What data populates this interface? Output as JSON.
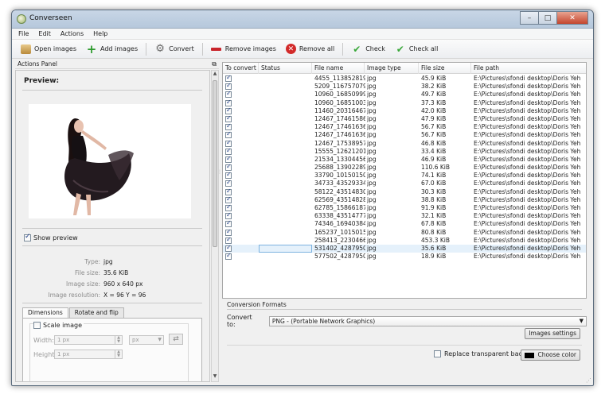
{
  "window": {
    "title": "Converseen",
    "minimize_glyph": "–",
    "maximize_glyph": "□",
    "close_glyph": "✕"
  },
  "menu": [
    "File",
    "Edit",
    "Actions",
    "Help"
  ],
  "toolbar": {
    "open_images": "Open images",
    "add_images": "Add images",
    "convert": "Convert",
    "remove_images": "Remove images",
    "remove_all": "Remove all",
    "check": "Check",
    "check_all": "Check all"
  },
  "actions_panel": {
    "title": "Actions Panel",
    "preview_title": "Preview:",
    "show_preview_label": "Show preview",
    "show_preview_checked": true,
    "info": {
      "type_label": "Type:",
      "type": "jpg",
      "file_size_label": "File size:",
      "file_size": "35.6 KiB",
      "image_size_label": "Image size:",
      "image_size": "960 x 640 px",
      "image_resolution_label": "Image resolution:",
      "image_resolution": "X = 96 Y = 96"
    },
    "tabs": [
      "Dimensions",
      "Rotate and flip"
    ],
    "active_tab": 0,
    "scale_image_label": "Scale image",
    "width_label": "Width:",
    "width_value": "1 px",
    "height_label": "Height:",
    "height_value": "1 px",
    "unit": "px"
  },
  "table": {
    "columns": [
      "To convert",
      "Status",
      "File name",
      "Image type",
      "File size",
      "File path"
    ],
    "selected_index": 21,
    "rows": [
      {
        "name": "4455_113852819...",
        "type": "jpg",
        "size": "45.9 KiB",
        "path": "E:\\Pictures\\sfondi desktop\\Doris Yeh"
      },
      {
        "name": "5209_116757079...",
        "type": "jpg",
        "size": "38.2 KiB",
        "path": "E:\\Pictures\\sfondi desktop\\Doris Yeh"
      },
      {
        "name": "10960_16850999...",
        "type": "jpg",
        "size": "49.7 KiB",
        "path": "E:\\Pictures\\sfondi desktop\\Doris Yeh"
      },
      {
        "name": "10960_16851003...",
        "type": "jpg",
        "size": "37.3 KiB",
        "path": "E:\\Pictures\\sfondi desktop\\Doris Yeh"
      },
      {
        "name": "11460_20316467...",
        "type": "jpg",
        "size": "42.0 KiB",
        "path": "E:\\Pictures\\sfondi desktop\\Doris Yeh"
      },
      {
        "name": "12467_17461586...",
        "type": "jpg",
        "size": "47.9 KiB",
        "path": "E:\\Pictures\\sfondi desktop\\Doris Yeh"
      },
      {
        "name": "12467_17461636...",
        "type": "jpg",
        "size": "56.7 KiB",
        "path": "E:\\Pictures\\sfondi desktop\\Doris Yeh"
      },
      {
        "name": "12467_17461636...",
        "type": "jpg",
        "size": "56.7 KiB",
        "path": "E:\\Pictures\\sfondi desktop\\Doris Yeh"
      },
      {
        "name": "12467_17538957...",
        "type": "jpg",
        "size": "46.8 KiB",
        "path": "E:\\Pictures\\sfondi desktop\\Doris Yeh"
      },
      {
        "name": "15555_12621201...",
        "type": "jpg",
        "size": "33.4 KiB",
        "path": "E:\\Pictures\\sfondi desktop\\Doris Yeh"
      },
      {
        "name": "21534_13304456...",
        "type": "jpg",
        "size": "46.9 KiB",
        "path": "E:\\Pictures\\sfondi desktop\\Doris Yeh"
      },
      {
        "name": "25688_13902289...",
        "type": "jpg",
        "size": "110.6 KiB",
        "path": "E:\\Pictures\\sfondi desktop\\Doris Yeh"
      },
      {
        "name": "33790_10150150...",
        "type": "jpg",
        "size": "74.1 KiB",
        "path": "E:\\Pictures\\sfondi desktop\\Doris Yeh"
      },
      {
        "name": "34733_43529334...",
        "type": "jpg",
        "size": "67.0 KiB",
        "path": "E:\\Pictures\\sfondi desktop\\Doris Yeh"
      },
      {
        "name": "58122_43514830...",
        "type": "jpg",
        "size": "30.3 KiB",
        "path": "E:\\Pictures\\sfondi desktop\\Doris Yeh"
      },
      {
        "name": "62569_43514828...",
        "type": "jpg",
        "size": "38.8 KiB",
        "path": "E:\\Pictures\\sfondi desktop\\Doris Yeh"
      },
      {
        "name": "62785_15866187...",
        "type": "jpg",
        "size": "91.9 KiB",
        "path": "E:\\Pictures\\sfondi desktop\\Doris Yeh"
      },
      {
        "name": "63338_43514777...",
        "type": "jpg",
        "size": "32.1 KiB",
        "path": "E:\\Pictures\\sfondi desktop\\Doris Yeh"
      },
      {
        "name": "74346_16940384...",
        "type": "jpg",
        "size": "67.8 KiB",
        "path": "E:\\Pictures\\sfondi desktop\\Doris Yeh"
      },
      {
        "name": "165237_1015015...",
        "type": "jpg",
        "size": "80.8 KiB",
        "path": "E:\\Pictures\\sfondi desktop\\Doris Yeh"
      },
      {
        "name": "258413_2230466...",
        "type": "jpg",
        "size": "453.3 KiB",
        "path": "E:\\Pictures\\sfondi desktop\\Doris Yeh"
      },
      {
        "name": "531402_4287950...",
        "type": "jpg",
        "size": "35.6 KiB",
        "path": "E:\\Pictures\\sfondi desktop\\Doris Yeh"
      },
      {
        "name": "577502_4287950...",
        "type": "jpg",
        "size": "18.9 KiB",
        "path": "E:\\Pictures\\sfondi desktop\\Doris Yeh"
      }
    ]
  },
  "conversion": {
    "title": "Conversion Formats",
    "convert_to_label": "Convert to:",
    "convert_to_value": "PNG - (Portable Network Graphics)",
    "image_settings": "Images settings",
    "replace_transparent_label": "Replace transparent background",
    "choose_color": "Choose color",
    "color": "#000000"
  },
  "colors": {
    "selection": "#e5f1fb",
    "check_mark": "#1f3f8a",
    "remove_red": "#d22a2a",
    "add_green": "#2c9a2c"
  }
}
